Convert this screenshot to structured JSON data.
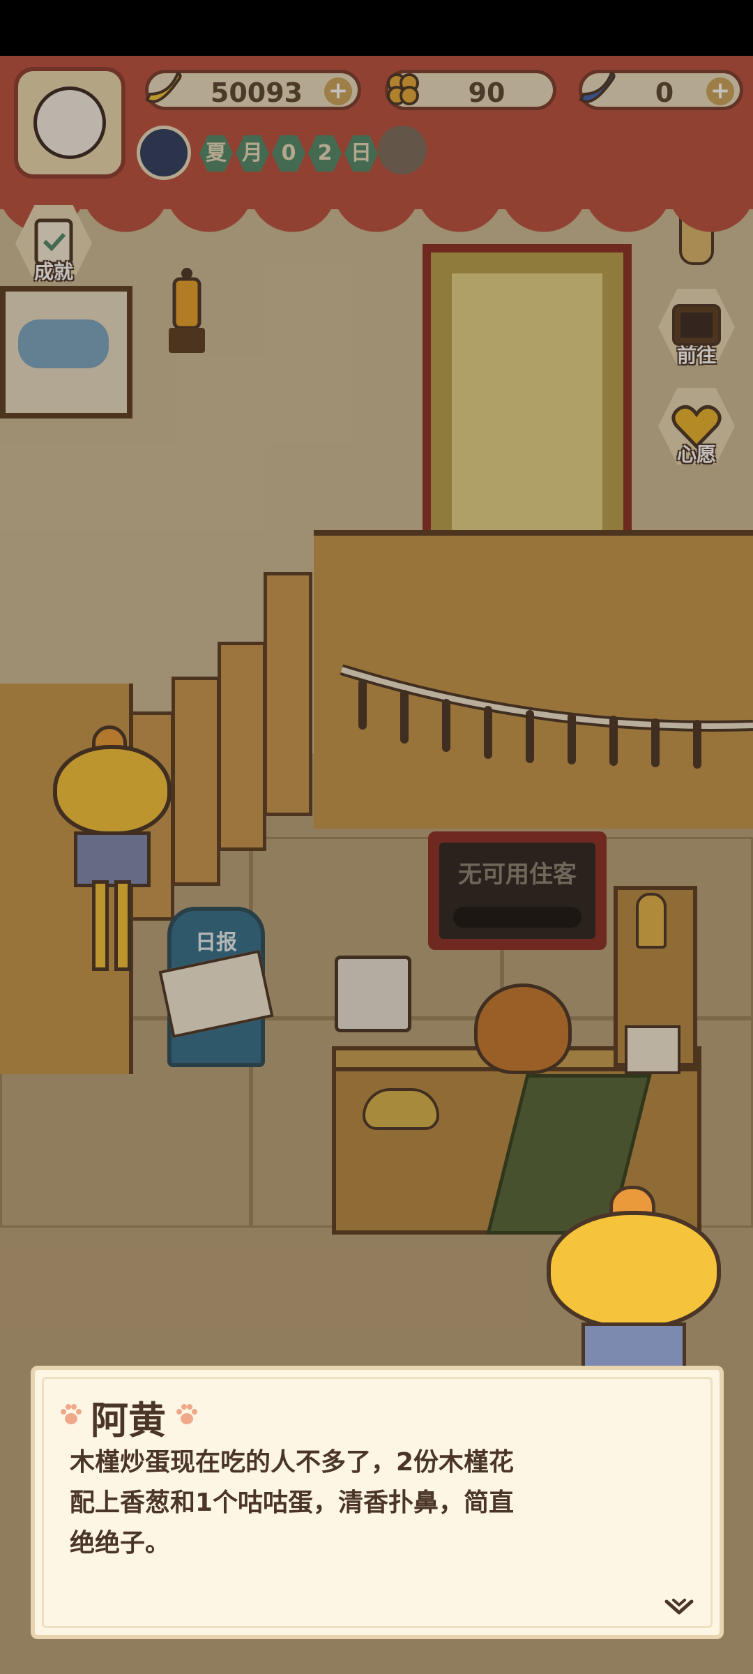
{
  "currencies": {
    "banana": {
      "value": "50093",
      "icon": "banana-icon"
    },
    "clover": {
      "value": "90",
      "icon": "clover-icon"
    },
    "blue_banana": {
      "value": "0",
      "icon": "blue-banana-icon"
    }
  },
  "date": {
    "chars": [
      "夏",
      "月",
      "0",
      "2",
      "日"
    ]
  },
  "side_buttons": {
    "achievement": "成就",
    "goto": "前往",
    "wish": "心愿"
  },
  "scene": {
    "board_text": "无可用住客",
    "newsstand_label": "日报"
  },
  "dialog": {
    "speaker": "阿黄",
    "lines": [
      "木槿炒蛋现在吃的人不多了，2份木槿花",
      "配上香葱和1个咕咕蛋，清香扑鼻，简直",
      "绝绝子。"
    ]
  },
  "colors": {
    "curtain": "#b9503f",
    "dialog_bg": "#fdf6e5",
    "text_dark": "#4a3526"
  }
}
